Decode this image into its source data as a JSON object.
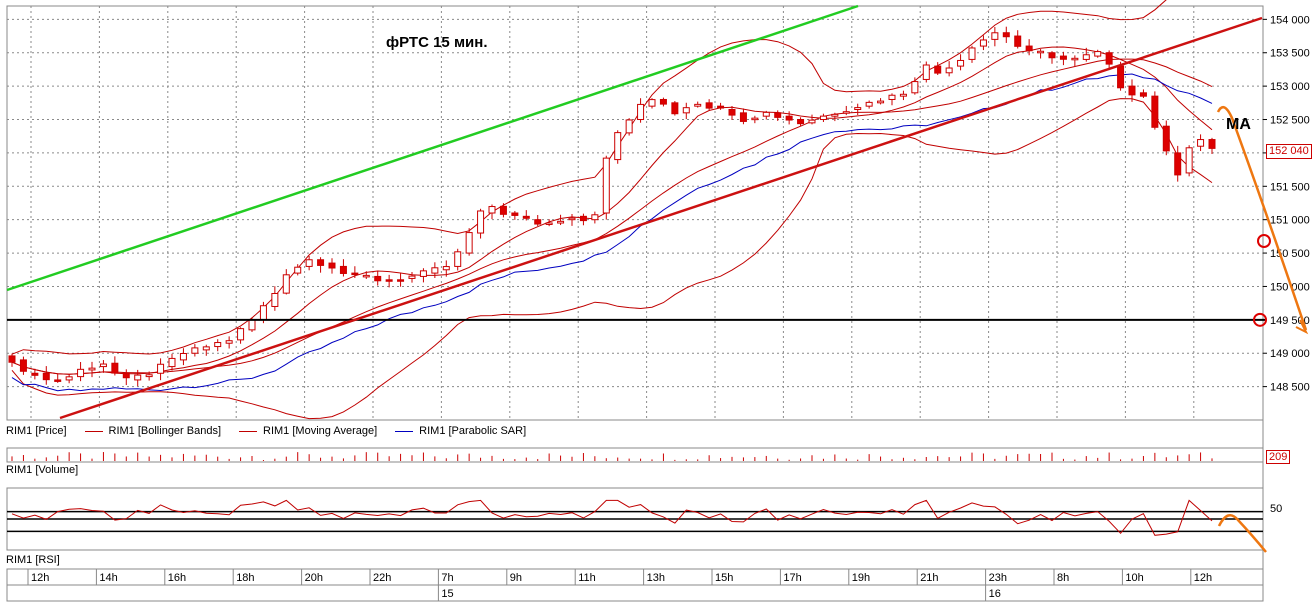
{
  "title": "фРТС   15 мин.",
  "ma_label": "MA",
  "legend": [
    {
      "label": "RIM1 [Price]",
      "color": ""
    },
    {
      "label": "RIM1 [Bollinger Bands]",
      "color": "#c00000"
    },
    {
      "label": "RIM1 [Moving Average]",
      "color": "#c00000"
    },
    {
      "label": "RIM1 [Parabolic SAR]",
      "color": "#0000c0"
    }
  ],
  "panels": {
    "volume_label": "RIM1 [Volume]",
    "rsi_label": "RIM1 [RSI]",
    "volume_badge": "209",
    "rsi_tick": "50"
  },
  "price_badge": "152 040",
  "colors": {
    "candle_up_fill": "#ffffff",
    "candle_down_fill": "#dd0000",
    "candle_stroke": "#cc0000",
    "bollinger": "#c00000",
    "moving_average": "#c00000",
    "parabolic_sar": "#0000c0",
    "green_trendline": "#22cc22",
    "red_trendline": "#cc1111",
    "forecast": "#ee7711",
    "grid": "#8a8a8a"
  },
  "chart_data": {
    "type": "candlestick",
    "ylim": [
      148000,
      154200
    ],
    "y_ticks": [
      "154 000",
      "153 500",
      "153 000",
      "152 500",
      "152 000",
      "151 500",
      "151 000",
      "150 500",
      "150 000",
      "149 500",
      "149 000",
      "148 500"
    ],
    "y_tick_values": [
      154000,
      153500,
      153000,
      152500,
      152000,
      151500,
      151000,
      150500,
      150000,
      149500,
      149000,
      148500
    ],
    "x_ticks": [
      "12h",
      "14h",
      "16h",
      "18h",
      "20h",
      "22h",
      "7h",
      "9h",
      "11h",
      "13h",
      "15h",
      "17h",
      "19h",
      "21h",
      "23h",
      "8h",
      "10h",
      "12h"
    ],
    "date_labels": [
      {
        "label": "15",
        "after_tick": "7h"
      },
      {
        "label": "16",
        "after_tick": "23h"
      }
    ],
    "support_level": 149500,
    "current_price": 152040,
    "price_path": [
      148900,
      148700,
      148700,
      148600,
      148600,
      148650,
      148750,
      148800,
      148850,
      148700,
      148600,
      148650,
      148700,
      148800,
      148900,
      149000,
      149050,
      149100,
      149150,
      149200,
      149350,
      149500,
      149700,
      149900,
      150200,
      150300,
      150400,
      150350,
      150300,
      150200,
      150150,
      150150,
      150100,
      150100,
      150120,
      150150,
      150200,
      150250,
      150300,
      150500,
      150800,
      151100,
      151200,
      151100,
      151050,
      151000,
      150950,
      150950,
      151000,
      151050,
      151000,
      151100,
      151900,
      152300,
      152500,
      152700,
      152800,
      152750,
      152600,
      152700,
      152750,
      152700,
      152650,
      152600,
      152500,
      152550,
      152600,
      152550,
      152500,
      152450,
      152500,
      152550,
      152600,
      152650,
      152700,
      152750,
      152800,
      152850,
      152900,
      153100,
      153300,
      153200,
      153300,
      153400,
      153600,
      153700,
      153800,
      153750,
      153600,
      153500,
      153500,
      153450,
      153400,
      153400,
      153450,
      153500,
      153300,
      153000,
      152900,
      152850,
      152400,
      152000,
      151700,
      152100,
      152200,
      152040
    ],
    "rsi_levels": [
      70,
      50,
      30
    ],
    "volume_max": 209
  }
}
